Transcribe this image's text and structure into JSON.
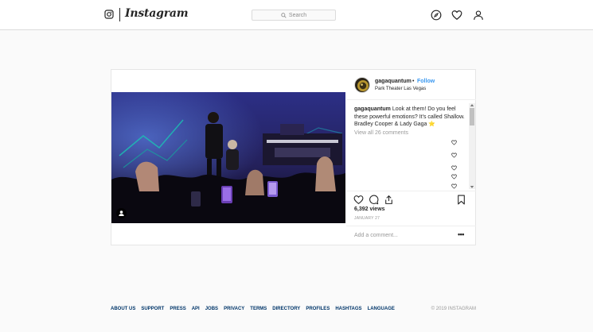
{
  "nav": {
    "wordmark": "Instagram",
    "search_placeholder": "Search",
    "icons": [
      "instagram-glyph-icon",
      "search-icon",
      "compass-icon",
      "heart-icon",
      "profile-icon"
    ]
  },
  "post": {
    "username": "gagaquantum",
    "separator": "•",
    "follow_label": "Follow",
    "location": "Park Theater Las Vegas",
    "caption_user": "gagaquantum",
    "caption_text": "Look at them! Do you feel these powerful emotions? It's called Shallow. Bradley Cooper & Lady Gaga ⭐",
    "view_all": "View all 26 comments",
    "views": "6,392 views",
    "date": "JANUARY 27",
    "add_comment_placeholder": "Add a comment...",
    "more": "•••",
    "media_kind": "video",
    "icons": [
      "heart-icon",
      "comment-icon",
      "share-icon",
      "bookmark-icon",
      "user-tag-icon",
      "more-options-icon"
    ]
  },
  "footer": {
    "links": [
      "ABOUT US",
      "SUPPORT",
      "PRESS",
      "API",
      "JOBS",
      "PRIVACY",
      "TERMS",
      "DIRECTORY",
      "PROFILES",
      "HASHTAGS",
      "LANGUAGE"
    ],
    "copyright": "© 2019 INSTAGRAM"
  },
  "colors": {
    "link_blue": "#3897f0",
    "footer_link": "#003569",
    "border": "#dbdbdb",
    "background": "#fafafa"
  }
}
